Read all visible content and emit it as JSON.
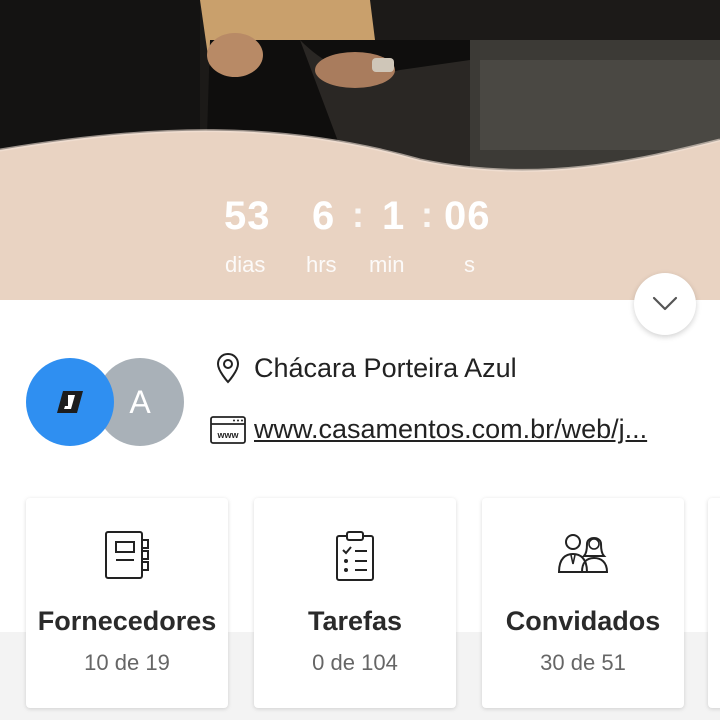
{
  "countdown": {
    "days": "53",
    "days_unit": "dias",
    "hours": "6",
    "hours_unit": "hrs",
    "minutes": "1",
    "minutes_unit": "min",
    "seconds": "06",
    "seconds_unit": "s",
    "separator": ":"
  },
  "event": {
    "avatar_letter": "A",
    "venue": "Chácara Porteira Azul",
    "website": "www.casamentos.com.br/web/j...",
    "website_icon_text": "www"
  },
  "cards": [
    {
      "title": "Fornecedores",
      "subtitle": "10 de 19",
      "icon": "vendors-notebook-icon"
    },
    {
      "title": "Tarefas",
      "subtitle": "0 de 104",
      "icon": "tasks-clipboard-icon"
    },
    {
      "title": "Convidados",
      "subtitle": "30 de 51",
      "icon": "guests-couple-icon"
    }
  ],
  "colors": {
    "hero_band": "#e9d3c2",
    "avatar_blue": "#2f8ff1",
    "avatar_gray": "#a9b1b8"
  }
}
